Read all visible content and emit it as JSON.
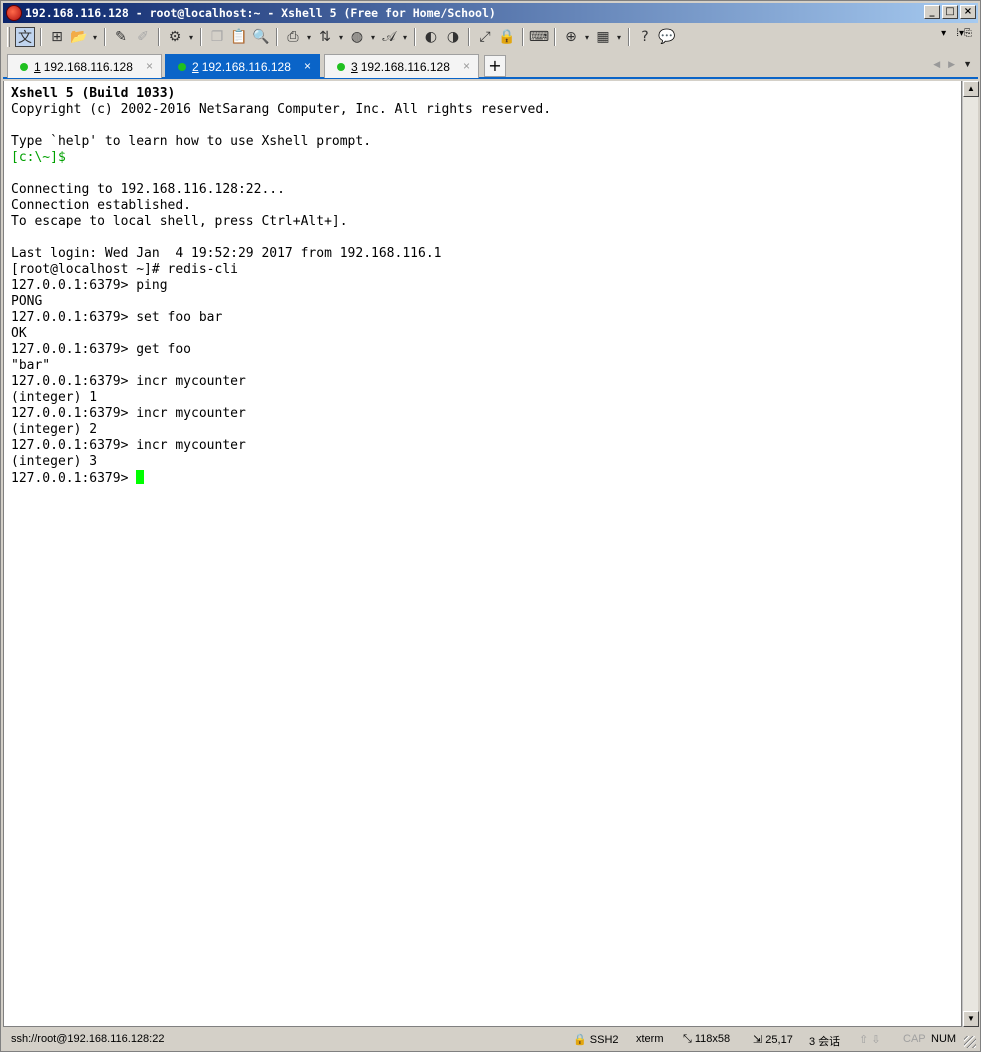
{
  "window": {
    "title": "192.168.116.128 - root@localhost:~ - Xshell 5 (Free for Home/School)",
    "controls": {
      "minimize": "_",
      "maximize": "□",
      "close": "×"
    }
  },
  "toolbar": {
    "icons": [
      "language-icon",
      "new-session-icon",
      "open-folder-icon",
      "edit-icon",
      "eraser-icon",
      "properties-icon",
      "copy-icon",
      "paste-icon",
      "find-icon",
      "print-icon",
      "transfer-icon",
      "globe-icon",
      "font-icon",
      "xftp-icon",
      "xftp-secure-icon",
      "fullscreen-icon",
      "lock-icon",
      "keyboard-icon",
      "add-icon",
      "layout-icon",
      "help-icon",
      "chat-icon"
    ]
  },
  "tabs": [
    {
      "num": "1",
      "label": " 192.168.116.128",
      "active": false
    },
    {
      "num": "2",
      "label": " 192.168.116.128",
      "active": true
    },
    {
      "num": "3",
      "label": " 192.168.116.128",
      "active": false
    }
  ],
  "terminal": {
    "cursor_color": "#00ff00",
    "lines": [
      {
        "text": "Xshell 5 (Build 1033)",
        "style": "bold"
      },
      {
        "text": "Copyright (c) 2002-2016 NetSarang Computer, Inc. All rights reserved.",
        "style": ""
      },
      {
        "text": "",
        "style": ""
      },
      {
        "text": "Type `help' to learn how to use Xshell prompt.",
        "style": ""
      },
      {
        "text": "[c:\\~]$",
        "style": "green"
      },
      {
        "text": "",
        "style": ""
      },
      {
        "text": "Connecting to 192.168.116.128:22...",
        "style": ""
      },
      {
        "text": "Connection established.",
        "style": ""
      },
      {
        "text": "To escape to local shell, press Ctrl+Alt+].",
        "style": ""
      },
      {
        "text": "",
        "style": ""
      },
      {
        "text": "Last login: Wed Jan  4 19:52:29 2017 from 192.168.116.1",
        "style": ""
      },
      {
        "text": "[root@localhost ~]# redis-cli",
        "style": ""
      },
      {
        "text": "127.0.0.1:6379> ping",
        "style": ""
      },
      {
        "text": "PONG",
        "style": ""
      },
      {
        "text": "127.0.0.1:6379> set foo bar",
        "style": ""
      },
      {
        "text": "OK",
        "style": ""
      },
      {
        "text": "127.0.0.1:6379> get foo",
        "style": ""
      },
      {
        "text": "\"bar\"",
        "style": ""
      },
      {
        "text": "127.0.0.1:6379> incr mycounter",
        "style": ""
      },
      {
        "text": "(integer) 1",
        "style": ""
      },
      {
        "text": "127.0.0.1:6379> incr mycounter",
        "style": ""
      },
      {
        "text": "(integer) 2",
        "style": ""
      },
      {
        "text": "127.0.0.1:6379> incr mycounter",
        "style": ""
      },
      {
        "text": "(integer) 3",
        "style": ""
      }
    ],
    "prompt": "127.0.0.1:6379> "
  },
  "statusbar": {
    "connection": "ssh://root@192.168.116.128:22",
    "protocol": "SSH2",
    "terminal_type": "xterm",
    "size": "118x58",
    "cursor_pos": "25,17",
    "sessions": "3 会话",
    "cap": "CAP",
    "num": "NUM"
  }
}
